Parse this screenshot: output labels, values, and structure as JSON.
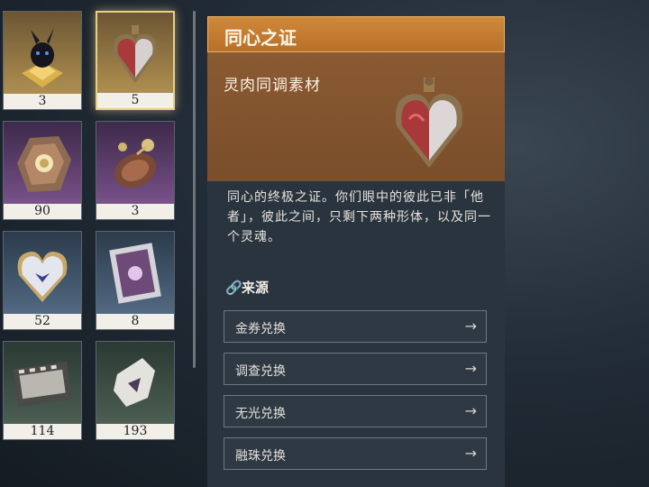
{
  "inventory": [
    {
      "count": "3",
      "rarity": "gold"
    },
    {
      "count": "5",
      "rarity": "gold",
      "selected": true
    },
    {
      "count": "90",
      "rarity": "purple"
    },
    {
      "count": "3",
      "rarity": "purple"
    },
    {
      "count": "52",
      "rarity": "blue"
    },
    {
      "count": "8",
      "rarity": "blue"
    },
    {
      "count": "114",
      "rarity": "green"
    },
    {
      "count": "193",
      "rarity": "green"
    }
  ],
  "detail": {
    "title": "同心之证",
    "subtitle": "灵肉同调素材",
    "description": "同心的终极之证。你们眼中的彼此已非「他者」，彼此之间，只剩下两种形体，以及同一个灵魂。",
    "source_heading": "来源",
    "sources": [
      "金券兑换",
      "调查兑换",
      "无光兑换",
      "融珠兑换"
    ]
  }
}
